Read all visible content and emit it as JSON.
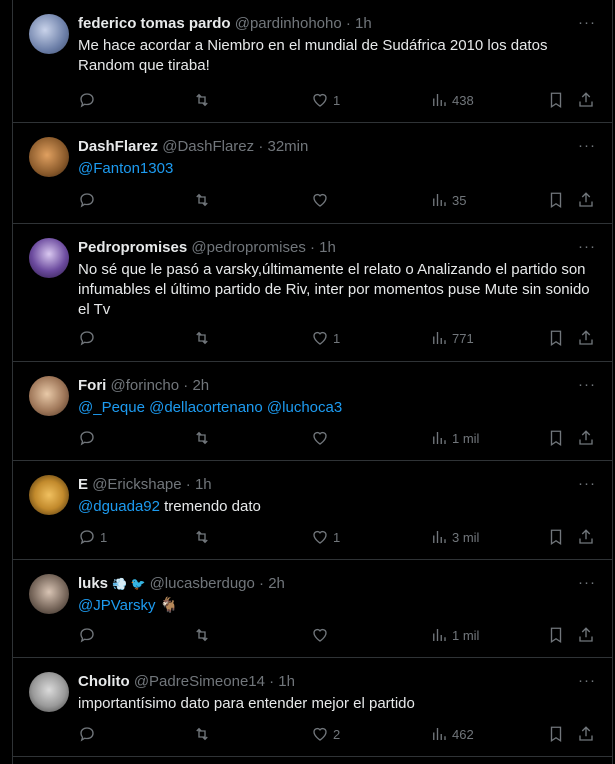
{
  "tweets": [
    {
      "name": "federico tomas pardo",
      "handle": "@pardinhohoho",
      "time": "· 1h",
      "text_parts": [
        "Me hace acordar a Niembro en el mundial de Sudáfrica 2010 los datos Random que tiraba!"
      ],
      "reply": "",
      "retweet": "",
      "like": "1",
      "views": "438",
      "avatar_color": "#6c7fa8"
    },
    {
      "name": "DashFlarez",
      "handle": "@DashFlarez",
      "time": "· 32min",
      "mentions": "@Fanton1303",
      "reply": "",
      "retweet": "",
      "like": "",
      "views": "35",
      "avatar_color": "#8a5a2b"
    },
    {
      "name": "Pedropromises",
      "handle": "@pedropromises",
      "time": "· 1h",
      "text": "No sé que le pasó a varsky,últimamente el relato o Analizando el partido son infumables el último partido de Riv, inter por momentos puse Mute sin sonido el Tv",
      "reply": "",
      "retweet": "",
      "like": "1",
      "views": "771",
      "avatar_color": "#6b4a9e"
    },
    {
      "name": "Fori",
      "handle": "@forincho",
      "time": "· 2h",
      "mentions": "@_Peque @dellacortenano @luchoca3",
      "reply": "",
      "retweet": "",
      "like": "",
      "views": "1 mil",
      "avatar_color": "#a0785a"
    },
    {
      "name": "E",
      "handle": "@Erickshape",
      "time": "· 1h",
      "mentions": "@dguada92",
      "text": " tremendo dato",
      "reply": "1",
      "retweet": "",
      "like": "1",
      "views": "3 mil",
      "avatar_color": "#c28a2c"
    },
    {
      "name": "luks",
      "badges": "💨 🐦",
      "handle": "@lucasberdugo",
      "time": "· 2h",
      "mentions": "@JPVarsky",
      "emoji": "🐐",
      "reply": "",
      "retweet": "",
      "like": "",
      "views": "1 mil",
      "avatar_color": "#7b6a5e"
    },
    {
      "name": "Cholito",
      "handle": "@PadreSimeone14",
      "time": "· 1h",
      "text": "importantísimo dato para entender mejor el partido",
      "reply": "",
      "retweet": "",
      "like": "2",
      "views": "462",
      "avatar_color": "#9a9a9a"
    }
  ],
  "more_label": "···"
}
